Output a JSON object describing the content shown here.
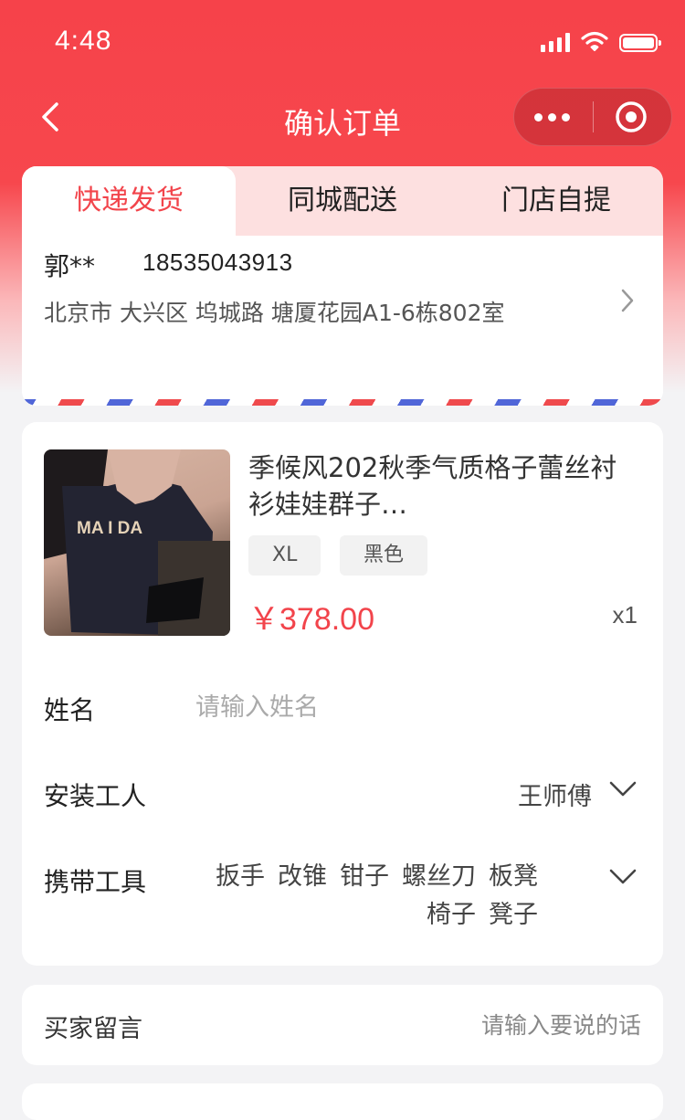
{
  "status_bar": {
    "time": "4:48"
  },
  "nav": {
    "title": "确认订单"
  },
  "colors": {
    "accent": "#f2444b",
    "tab_bar_bg": "#fde0e0",
    "stripe_red": "#ef4a4d",
    "stripe_blue": "#5066d8"
  },
  "delivery_tabs": [
    {
      "label": "快递发货",
      "active": true
    },
    {
      "label": "同城配送",
      "active": false
    },
    {
      "label": "门店自提",
      "active": false
    }
  ],
  "address": {
    "name": "郭**",
    "phone": "18535043913",
    "detail": "北京市 大兴区 坞城路 塘厦花园A1-6栋802室"
  },
  "product": {
    "title": "季候风202秋季气质格子蕾丝衬衫娃娃群子…",
    "specs": [
      "XL",
      "黑色"
    ],
    "price": "￥378.00",
    "quantity": "x1"
  },
  "form": {
    "name_label": "姓名",
    "name_placeholder": "请输入姓名",
    "worker_label": "安装工人",
    "worker_value": "王师傅",
    "tools_label": "携带工具",
    "tools": [
      "扳手",
      "改锥",
      "钳子",
      "螺丝刀",
      "板凳",
      "椅子",
      "凳子"
    ]
  },
  "message": {
    "label": "买家留言",
    "placeholder": "请输入要说的话"
  },
  "icons": [
    "back-icon",
    "more-icon",
    "target-icon",
    "chevron-right-icon",
    "chevron-down-icon",
    "signal-icon",
    "wifi-icon",
    "battery-icon"
  ]
}
